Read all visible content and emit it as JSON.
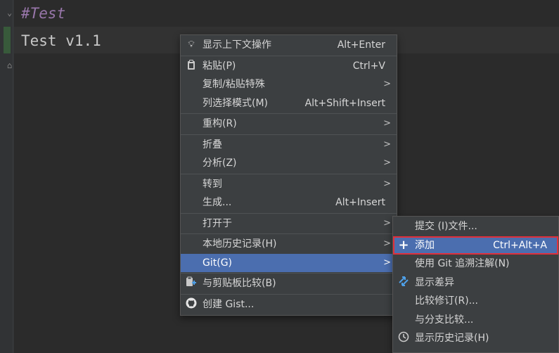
{
  "editor": {
    "lines": [
      "#Test",
      "Test v1.1"
    ]
  },
  "context_menu": {
    "items": [
      {
        "icon": "lightbulb-icon",
        "label": "显示上下文操作",
        "shortcut": "Alt+Enter"
      },
      {
        "icon": "clipboard-icon",
        "label": "粘贴(P)",
        "shortcut": "Ctrl+V"
      },
      {
        "label": "复制/粘贴特殊",
        "submenu": true
      },
      {
        "label": "列选择模式(M)",
        "shortcut": "Alt+Shift+Insert"
      },
      {
        "label": "重构(R)",
        "submenu": true
      },
      {
        "label": "折叠",
        "submenu": true
      },
      {
        "label": "分析(Z)",
        "submenu": true
      },
      {
        "label": "转到",
        "submenu": true
      },
      {
        "label": "生成...",
        "shortcut": "Alt+Insert"
      },
      {
        "label": "打开于",
        "submenu": true
      },
      {
        "label": "本地历史记录(H)",
        "submenu": true
      },
      {
        "label": "Git(G)",
        "submenu": true,
        "selected": true
      },
      {
        "icon": "clipboard-compare-icon",
        "label": "与剪贴板比较(B)"
      },
      {
        "icon": "github-icon",
        "label": "创建 Gist..."
      }
    ]
  },
  "git_submenu": {
    "items": [
      {
        "label": "提交 (I)文件..."
      },
      {
        "icon": "plus-icon",
        "label": "添加",
        "shortcut": "Ctrl+Alt+A",
        "highlighted": true
      },
      {
        "label": "使用 Git 追溯注解(N)"
      },
      {
        "icon": "diff-icon",
        "label": "显示差异"
      },
      {
        "label": "比较修订(R)..."
      },
      {
        "label": "与分支比较..."
      },
      {
        "icon": "clock-icon",
        "label": "显示历史记录(H)"
      }
    ]
  },
  "colors": {
    "selection": "#4b6eaf",
    "highlight_border": "#e0303b",
    "menu_bg": "#3c3f41",
    "editor_bg": "#2b2b2b"
  }
}
